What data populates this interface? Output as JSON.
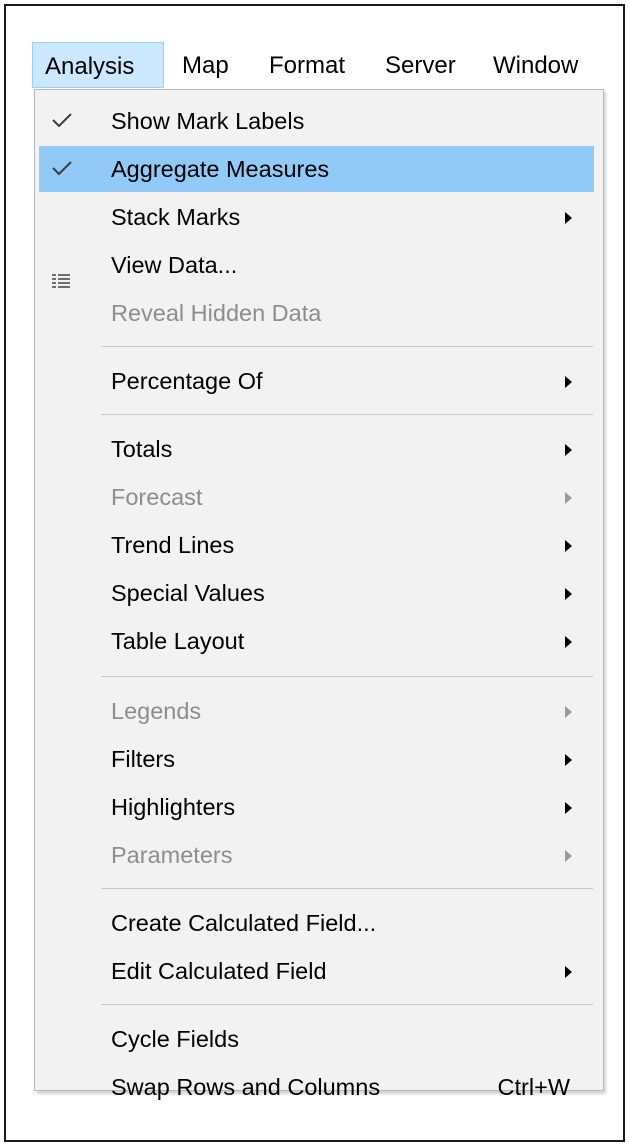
{
  "menubar": {
    "items": [
      {
        "label": "Analysis"
      },
      {
        "label": "Map"
      },
      {
        "label": "Format"
      },
      {
        "label": "Server"
      },
      {
        "label": "Window"
      }
    ]
  },
  "menu": {
    "show_mark_labels": "Show Mark Labels",
    "aggregate_measures": "Aggregate Measures",
    "stack_marks": "Stack Marks",
    "view_data": "View Data...",
    "reveal_hidden_data": "Reveal Hidden Data",
    "percentage_of": "Percentage Of",
    "totals": "Totals",
    "forecast": "Forecast",
    "trend_lines": "Trend Lines",
    "special_values": "Special Values",
    "table_layout": "Table Layout",
    "legends": "Legends",
    "filters": "Filters",
    "highlighters": "Highlighters",
    "parameters": "Parameters",
    "create_calculated_field": "Create Calculated Field...",
    "edit_calculated_field": "Edit Calculated Field",
    "cycle_fields": "Cycle Fields",
    "swap_rows_columns": "Swap Rows and Columns",
    "swap_shortcut": "Ctrl+W"
  },
  "colors": {
    "selected_row": "#91c9f7",
    "active_menu": "#cce8ff",
    "disabled_text": "#8d8d8d",
    "check_color": "#3c3c3c"
  },
  "icons": {
    "checked_items": [
      "check-icon"
    ],
    "view_data": "data-grid-icon",
    "submenu": "submenu-arrow-icon"
  }
}
